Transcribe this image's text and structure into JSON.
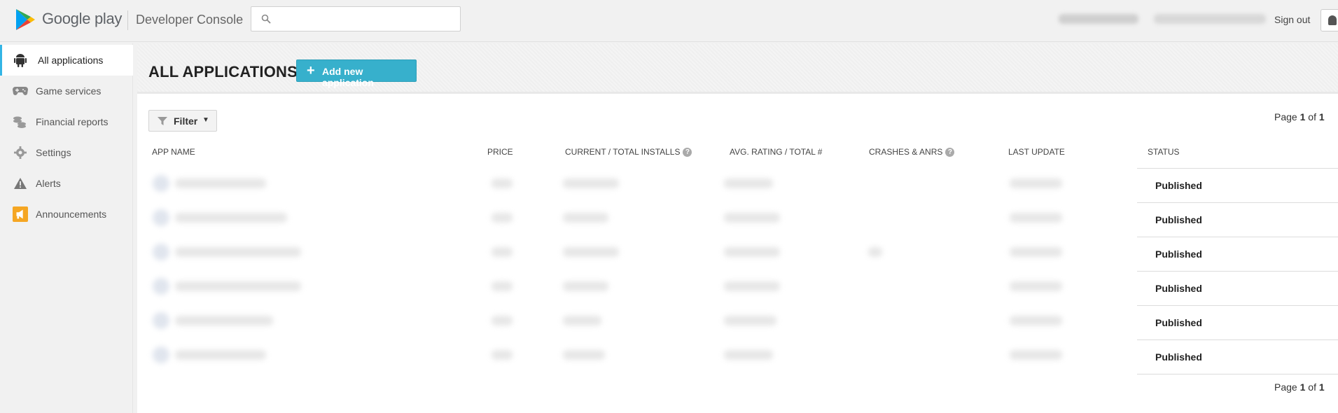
{
  "header": {
    "brand": "Google play",
    "console_title": "Developer Console",
    "search_placeholder": "",
    "sign_out": "Sign out"
  },
  "sidebar": {
    "items": [
      {
        "label": "All applications",
        "icon": "android-icon",
        "active": true
      },
      {
        "label": "Game services",
        "icon": "gamepad-icon",
        "active": false
      },
      {
        "label": "Financial reports",
        "icon": "coins-icon",
        "active": false
      },
      {
        "label": "Settings",
        "icon": "gear-icon",
        "active": false
      },
      {
        "label": "Alerts",
        "icon": "warning-icon",
        "active": false
      },
      {
        "label": "Announcements",
        "icon": "megaphone-icon",
        "active": false
      }
    ]
  },
  "main": {
    "title": "ALL APPLICATIONS",
    "add_button": "Add new application",
    "filter_label": "Filter",
    "pager_top": {
      "prefix": "Page ",
      "current": "1",
      "sep": " of ",
      "total": "1"
    },
    "pager_bottom": {
      "prefix": "Page ",
      "current": "1",
      "sep": " of ",
      "total": "1"
    },
    "columns": {
      "app_name": "APP NAME",
      "price": "PRICE",
      "installs": "CURRENT / TOTAL INSTALLS",
      "rating": "AVG. RATING / TOTAL #",
      "crashes": "CRASHES & ANRS",
      "last_update": "LAST UPDATE",
      "status": "STATUS"
    },
    "rows": [
      {
        "status": "Published"
      },
      {
        "status": "Published"
      },
      {
        "status": "Published"
      },
      {
        "status": "Published"
      },
      {
        "status": "Published"
      },
      {
        "status": "Published"
      }
    ]
  },
  "colors": {
    "accent_button": "#37b0cc",
    "active_nav_border": "#33b5e5",
    "announcements_icon": "#f5a623"
  }
}
